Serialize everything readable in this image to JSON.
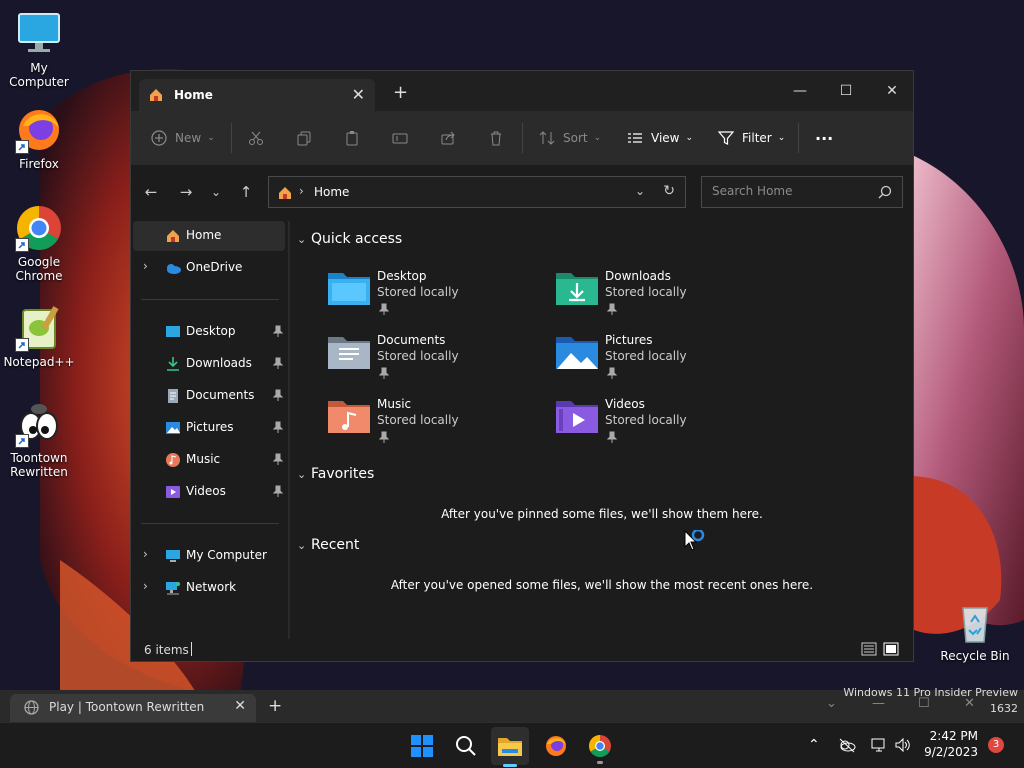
{
  "desktop": {
    "icons": [
      {
        "label": "My Computer"
      },
      {
        "label": "Firefox"
      },
      {
        "label": "Google Chrome"
      },
      {
        "label": "Notepad++"
      },
      {
        "label": "Toontown Rewritten"
      },
      {
        "label": "Recycle Bin"
      }
    ]
  },
  "explorer": {
    "tab_title": "Home",
    "toolbar": {
      "new_label": "New",
      "sort_label": "Sort",
      "view_label": "View",
      "filter_label": "Filter",
      "more_label": "···"
    },
    "address": {
      "crumb": "Home",
      "search_placeholder": "Search Home"
    },
    "nav": {
      "items": [
        {
          "label": "Home"
        },
        {
          "label": "OneDrive"
        },
        {
          "label": "Desktop"
        },
        {
          "label": "Downloads"
        },
        {
          "label": "Documents"
        },
        {
          "label": "Pictures"
        },
        {
          "label": "Music"
        },
        {
          "label": "Videos"
        },
        {
          "label": "My Computer"
        },
        {
          "label": "Network"
        }
      ]
    },
    "quick_access": {
      "title": "Quick access",
      "items": [
        {
          "name": "Desktop",
          "status": "Stored locally"
        },
        {
          "name": "Downloads",
          "status": "Stored locally"
        },
        {
          "name": "Documents",
          "status": "Stored locally"
        },
        {
          "name": "Pictures",
          "status": "Stored locally"
        },
        {
          "name": "Music",
          "status": "Stored locally"
        },
        {
          "name": "Videos",
          "status": "Stored locally"
        }
      ]
    },
    "favorites": {
      "title": "Favorites",
      "empty_message": "After you've pinned some files, we'll show them here."
    },
    "recent": {
      "title": "Recent",
      "empty_message": "After you've opened some files, we'll show the most recent ones here."
    },
    "status": {
      "item_count": "6 items"
    }
  },
  "chrome_window": {
    "tab_title": "Play | Toontown Rewritten"
  },
  "watermark": {
    "line1": "Windows 11 Pro Insider Preview",
    "line2": "1632"
  },
  "taskbar": {
    "time": "2:42 PM",
    "date": "9/2/2023",
    "notification_count": "3"
  },
  "colors": {
    "accent": "#60cdff",
    "window_bg": "#1c1c1c",
    "toolbar_bg": "#2b2b2b",
    "notif_badge": "#e0473f"
  }
}
